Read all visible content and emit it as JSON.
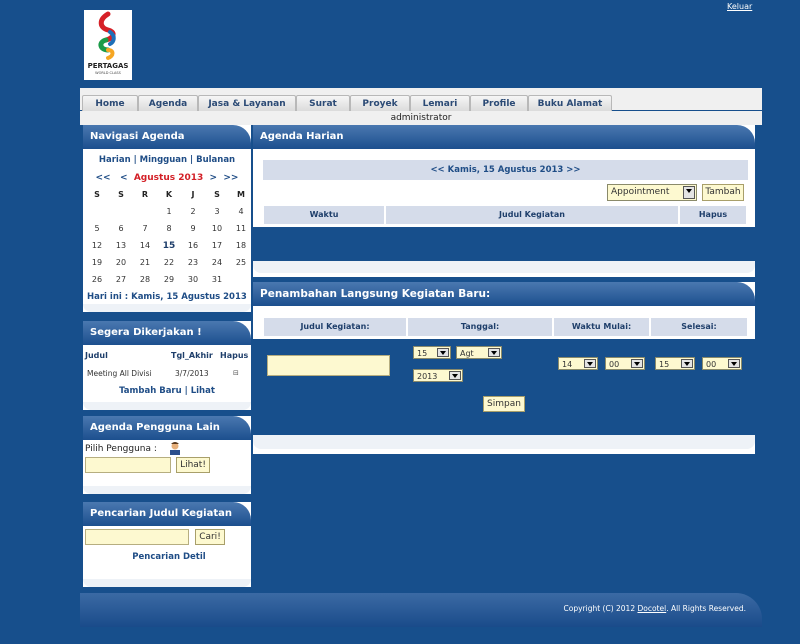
{
  "header": {
    "logout": "Keluar",
    "logo_text": "PERTAGAS",
    "logo_sub": "WORLD CLASS",
    "user": "administrator"
  },
  "menu": [
    {
      "id": "home",
      "label": "Home"
    },
    {
      "id": "agenda",
      "label": "Agenda"
    },
    {
      "id": "jasa",
      "label": "Jasa & Layanan"
    },
    {
      "id": "surat",
      "label": "Surat"
    },
    {
      "id": "proyek",
      "label": "Proyek"
    },
    {
      "id": "lemari",
      "label": "Lemari"
    },
    {
      "id": "profile",
      "label": "Profile"
    },
    {
      "id": "buku",
      "label": "Buku Alamat"
    }
  ],
  "nav_agenda": {
    "title": "Navigasi Agenda",
    "views": "Harian | Mingguan | Bulanan",
    "prev_year": "<<",
    "prev_month": "<",
    "month": "Agustus 2013",
    "next_month": ">",
    "next_year": ">>",
    "weekdays": [
      "S",
      "S",
      "R",
      "K",
      "J",
      "S",
      "M"
    ],
    "weeks": [
      [
        "",
        "",
        "",
        "1",
        "2",
        "3",
        "4"
      ],
      [
        "5",
        "6",
        "7",
        "8",
        "9",
        "10",
        "11"
      ],
      [
        "12",
        "13",
        "14",
        "15",
        "16",
        "17",
        "18"
      ],
      [
        "19",
        "20",
        "21",
        "22",
        "23",
        "24",
        "25"
      ],
      [
        "26",
        "27",
        "28",
        "29",
        "30",
        "31",
        ""
      ]
    ],
    "today_label": "Hari ini : Kamis, 15 Agustus 2013"
  },
  "segera": {
    "title": "Segera Dikerjakan !",
    "col_judul": "Judul",
    "col_tgl": "Tgl_Akhir",
    "col_hapus": "Hapus",
    "row_judul": "Meeting All Divisi",
    "row_tgl": "3/7/2013",
    "links": "Tambah Baru | Lihat"
  },
  "pengguna": {
    "title": "Agenda Pengguna Lain",
    "label": "Pilih Pengguna :",
    "button": "Lihat!"
  },
  "pencarian": {
    "title": "Pencarian Judul Kegiatan",
    "button": "Cari!",
    "detail": "Pencarian Detil"
  },
  "harian": {
    "title": "Agenda Harian",
    "date_nav": "<<  Kamis, 15 Agustus 2013  >>",
    "type_select": "Appointment",
    "add_button": "Tambah",
    "col_waktu": "Waktu",
    "col_judul": "Judul Kegiatan",
    "col_hapus": "Hapus"
  },
  "penambahan": {
    "title": "Penambahan Langsung Kegiatan Baru:",
    "col_judul": "Judul Kegiatan:",
    "col_tanggal": "Tanggal:",
    "col_mulai": "Waktu Mulai:",
    "col_selesai": "Selesai:",
    "day": "15",
    "month": "Agt",
    "year": "2013",
    "start_hour": "14",
    "start_min": "00",
    "end_hour": "15",
    "end_min": "00",
    "save": "Simpan"
  },
  "footer": {
    "copyright_pre": "Copyright (C) 2012 ",
    "company": "Docotel",
    "copyright_post": ". All Rights Reserved."
  }
}
